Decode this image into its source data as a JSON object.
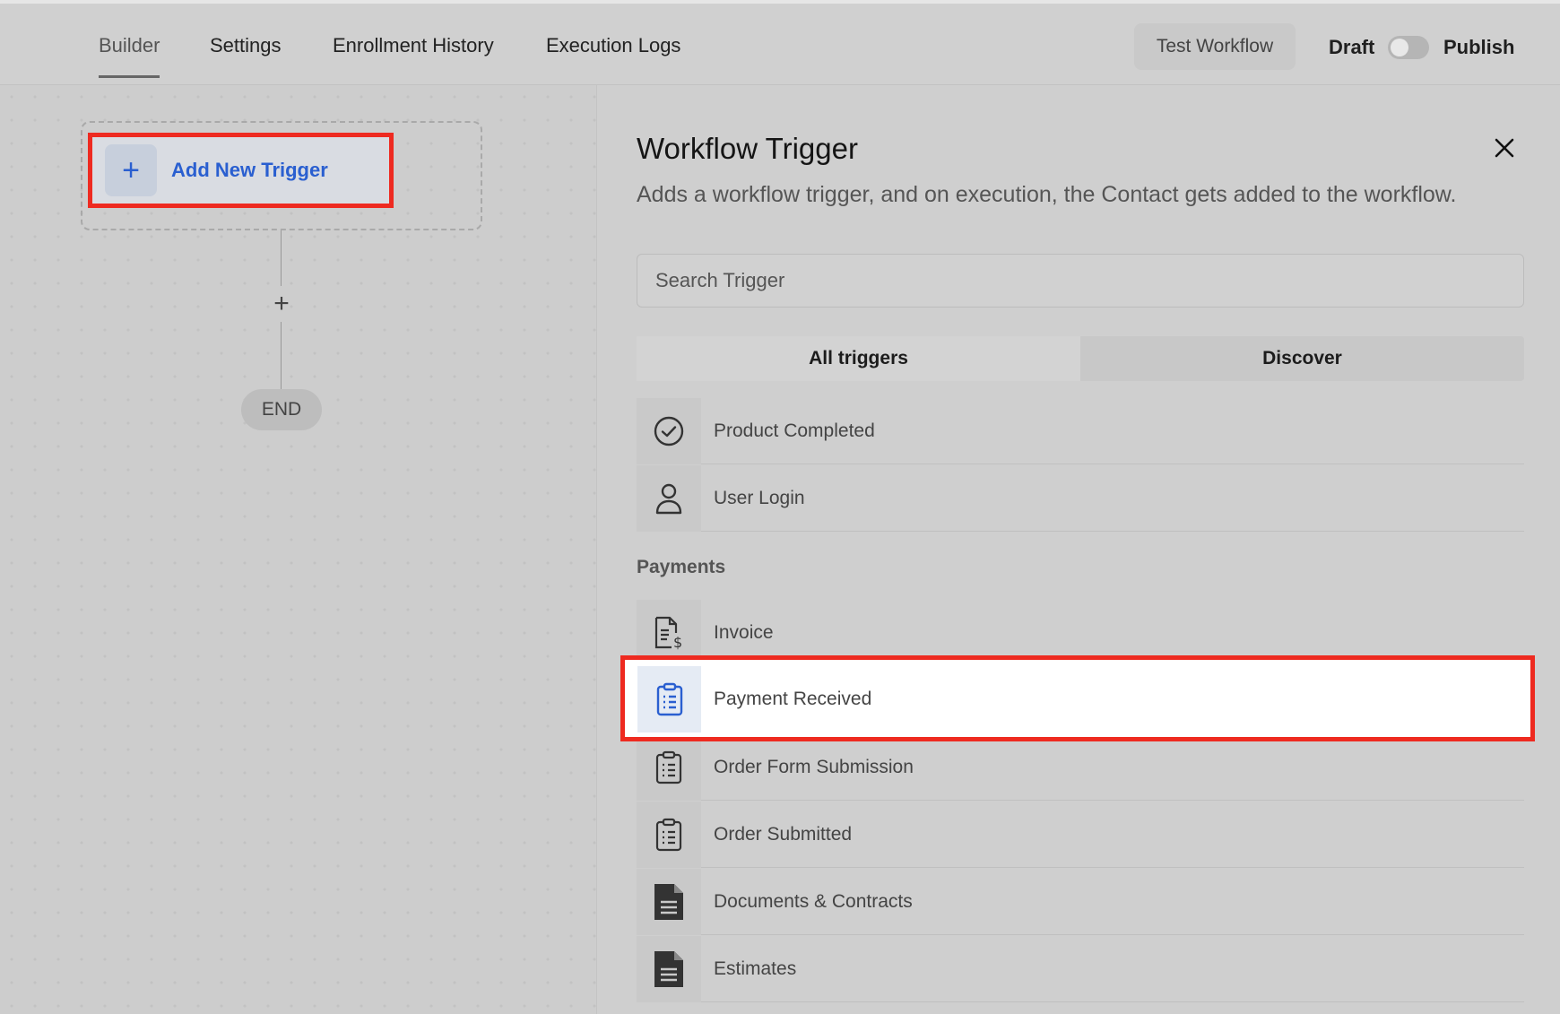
{
  "tabs": [
    {
      "label": "Builder",
      "active": true
    },
    {
      "label": "Settings"
    },
    {
      "label": "Enrollment History"
    },
    {
      "label": "Execution Logs"
    }
  ],
  "header": {
    "test_button": "Test Workflow",
    "draft_label": "Draft",
    "publish_label": "Publish",
    "publish_toggle_on": false
  },
  "canvas": {
    "add_trigger_label": "Add New Trigger",
    "add_step_glyph": "+",
    "end_label": "END"
  },
  "panel": {
    "title": "Workflow Trigger",
    "description": "Adds a workflow trigger, and on execution, the Contact gets added to the workflow.",
    "search_placeholder": "Search Trigger",
    "segments": [
      "All triggers",
      "Discover"
    ],
    "items_top": [
      {
        "label": "Product Completed",
        "icon": "check-circle-icon"
      },
      {
        "label": "User Login",
        "icon": "user-icon"
      }
    ],
    "section_payments": "Payments",
    "items_payments": [
      {
        "label": "Invoice",
        "icon": "invoice-dollar-icon"
      },
      {
        "label": "Payment Received",
        "icon": "clipboard-list-icon",
        "highlighted": true
      },
      {
        "label": "Order Form Submission",
        "icon": "clipboard-list-icon"
      },
      {
        "label": "Order Submitted",
        "icon": "clipboard-list-icon"
      },
      {
        "label": "Documents & Contracts",
        "icon": "document-icon"
      },
      {
        "label": "Estimates",
        "icon": "document-icon"
      }
    ]
  },
  "colors": {
    "accent_blue": "#2a5fd0",
    "highlight_red": "#ee2a20"
  }
}
